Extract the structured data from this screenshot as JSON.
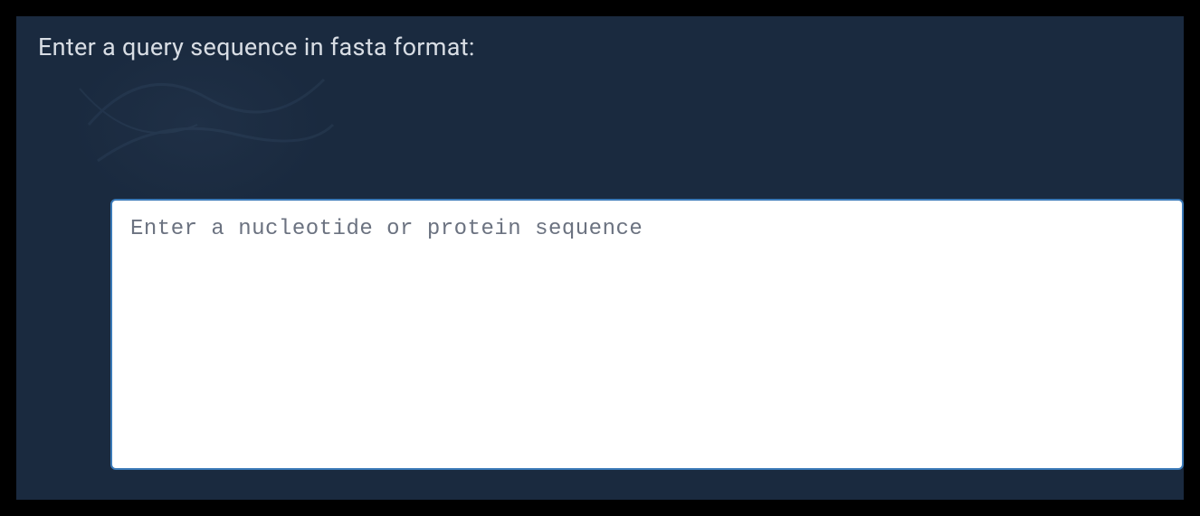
{
  "form": {
    "label": "Enter a query sequence in fasta format:",
    "textarea": {
      "placeholder": "Enter a nucleotide or protein sequence",
      "value": ""
    }
  },
  "colors": {
    "background": "#000000",
    "panel": "#1a2a3f",
    "label_text": "#d8dde4",
    "input_background": "#ffffff",
    "input_border": "#3b7ab8",
    "placeholder": "#6b7280"
  }
}
